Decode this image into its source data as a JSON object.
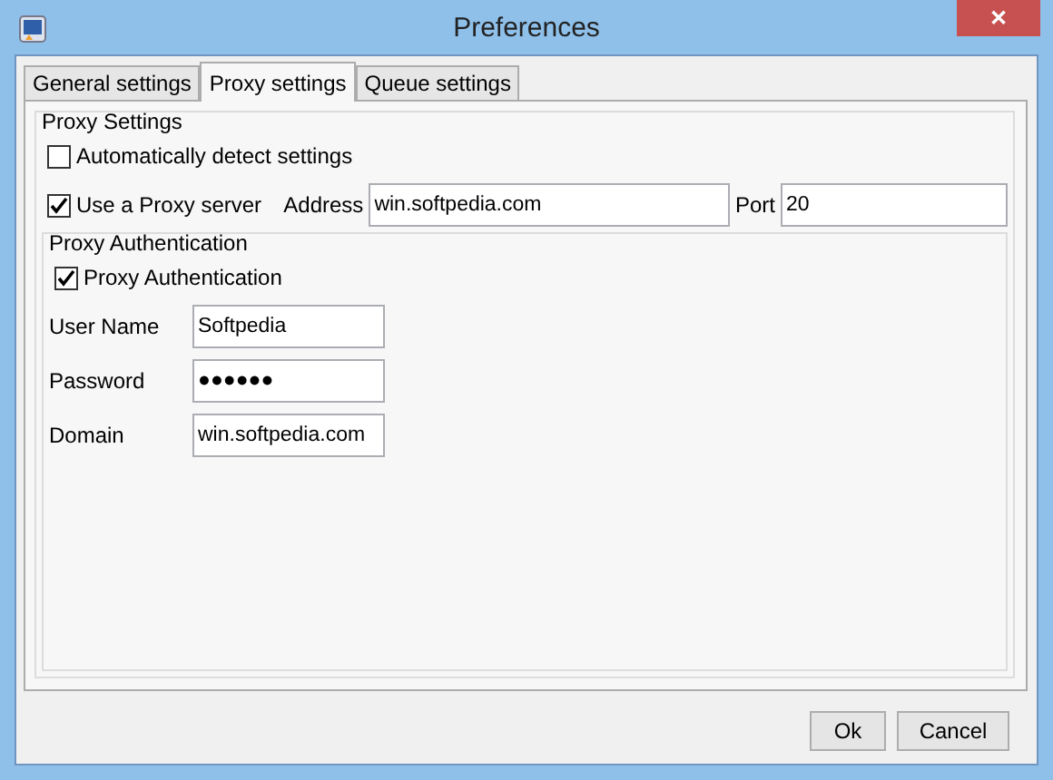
{
  "window": {
    "title": "Preferences",
    "close": "✕"
  },
  "tabs": [
    {
      "label": "General settings",
      "selected": false
    },
    {
      "label": "Proxy settings",
      "selected": true
    },
    {
      "label": "Queue settings",
      "selected": false
    }
  ],
  "proxy_settings": {
    "title": "Proxy Settings",
    "auto_detect": {
      "label": "Automatically detect settings",
      "checked": false
    },
    "use_proxy": {
      "label": "Use a Proxy server",
      "checked": true
    },
    "address": {
      "label": "Address",
      "value": "win.softpedia.com"
    },
    "port": {
      "label": "Port",
      "value": "20"
    }
  },
  "authentication": {
    "title": "Proxy Authentication",
    "enabled": {
      "label": "Proxy Authentication",
      "checked": true
    },
    "fields": [
      {
        "label": "User Name",
        "value": "Softpedia"
      },
      {
        "label": "Password",
        "value": "●●●●●●"
      },
      {
        "label": "Domain",
        "value": "win.softpedia.com"
      }
    ]
  },
  "buttons": [
    "Ok",
    "Cancel"
  ]
}
